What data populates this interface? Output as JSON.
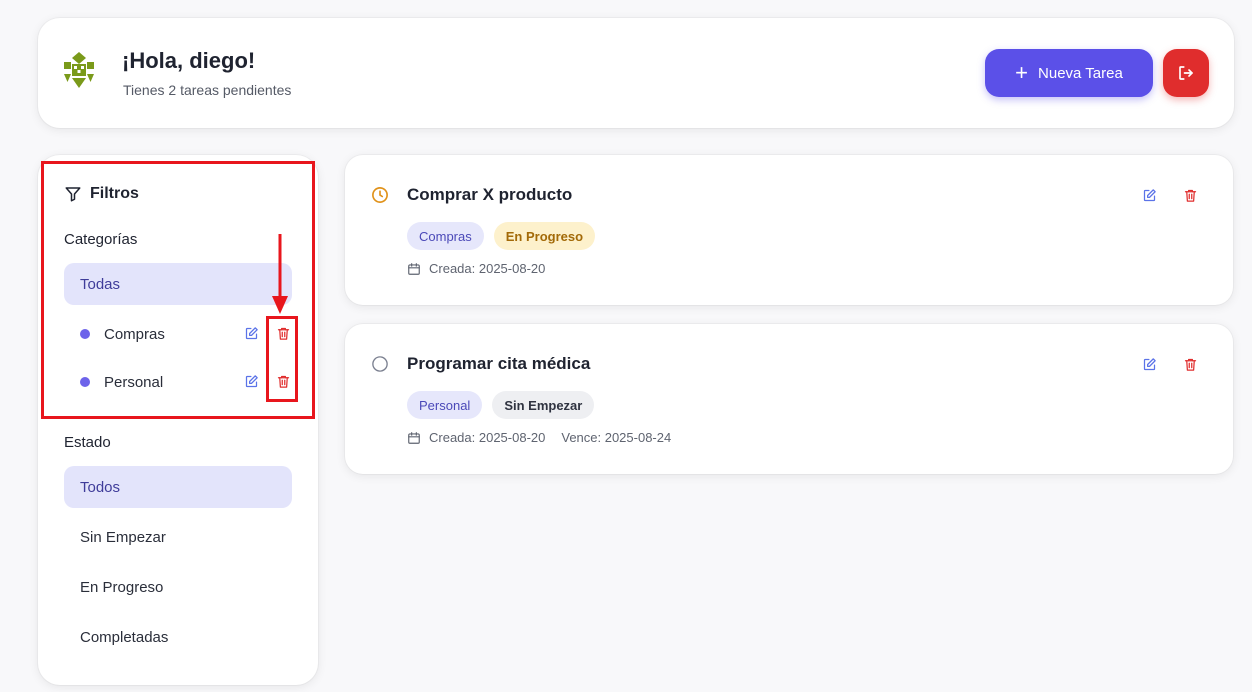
{
  "header": {
    "greeting": "¡Hola, diego!",
    "subtitle": "Tienes 2 tareas pendientes",
    "new_task_label": "Nueva Tarea",
    "avatar_icon": "identicon-avatar",
    "logout_icon": "logout-icon"
  },
  "sidebar": {
    "title": "Filtros",
    "categories_heading": "Categorías",
    "categories_all": "Todas",
    "categories": [
      {
        "label": "Compras",
        "color": "#6d63ea"
      },
      {
        "label": "Personal",
        "color": "#6d63ea"
      }
    ],
    "status_heading": "Estado",
    "status_items": [
      "Todos",
      "Sin Empezar",
      "En Progreso",
      "Completadas"
    ]
  },
  "tasks": [
    {
      "title": "Comprar X producto",
      "category": "Compras",
      "status": "En Progreso",
      "created": "Creada: 2025-08-20",
      "due": ""
    },
    {
      "title": "Programar cita médica",
      "category": "Personal",
      "status": "Sin Empezar",
      "created": "Creada: 2025-08-20",
      "due": "Vence: 2025-08-24"
    }
  ],
  "colors": {
    "accent": "#5b50e8",
    "danger": "#e02d2d",
    "annotation": "#e8161d"
  }
}
